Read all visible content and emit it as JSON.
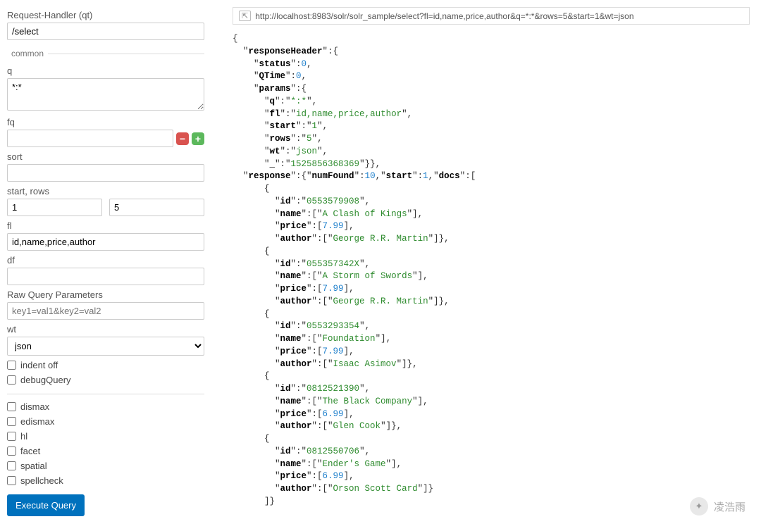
{
  "sidebar": {
    "request_handler_label": "Request-Handler (qt)",
    "request_handler_value": "/select",
    "common_legend": "common",
    "q_label": "q",
    "q_value": "*:*",
    "fq_label": "fq",
    "fq_value": "",
    "sort_label": "sort",
    "sort_value": "",
    "start_rows_label": "start, rows",
    "start_value": "1",
    "rows_value": "5",
    "fl_label": "fl",
    "fl_value": "id,name,price,author",
    "df_label": "df",
    "df_value": "",
    "raw_label": "Raw Query Parameters",
    "raw_placeholder": "key1=val1&key2=val2",
    "wt_label": "wt",
    "wt_value": "json",
    "indent_off": "indent off",
    "debug_query": "debugQuery",
    "dismax": "dismax",
    "edismax": "edismax",
    "hl": "hl",
    "facet": "facet",
    "spatial": "spatial",
    "spellcheck": "spellcheck",
    "execute": "Execute Query"
  },
  "url": "http://localhost:8983/solr/solr_sample/select?fl=id,name,price,author&q=*:*&rows=5&start=1&wt=json",
  "watermark": "凌浩雨",
  "response": {
    "header": {
      "status": 0,
      "QTime": 0
    },
    "params": {
      "q": "*:*",
      "fl": "id,name,price,author",
      "start": "1",
      "rows": "5",
      "wt": "json",
      "_": "1525856368369"
    },
    "numFound": 10,
    "start": 1,
    "docs": [
      {
        "id": "0553579908",
        "name": "A Clash of Kings",
        "price": 7.99,
        "author": "George R.R. Martin"
      },
      {
        "id": "055357342X",
        "name": "A Storm of Swords",
        "price": 7.99,
        "author": "George R.R. Martin"
      },
      {
        "id": "0553293354",
        "name": "Foundation",
        "price": 7.99,
        "author": "Isaac Asimov"
      },
      {
        "id": "0812521390",
        "name": "The Black Company",
        "price": 6.99,
        "author": "Glen Cook"
      },
      {
        "id": "0812550706",
        "name": "Ender's Game",
        "price": 6.99,
        "author": "Orson Scott Card"
      }
    ]
  }
}
